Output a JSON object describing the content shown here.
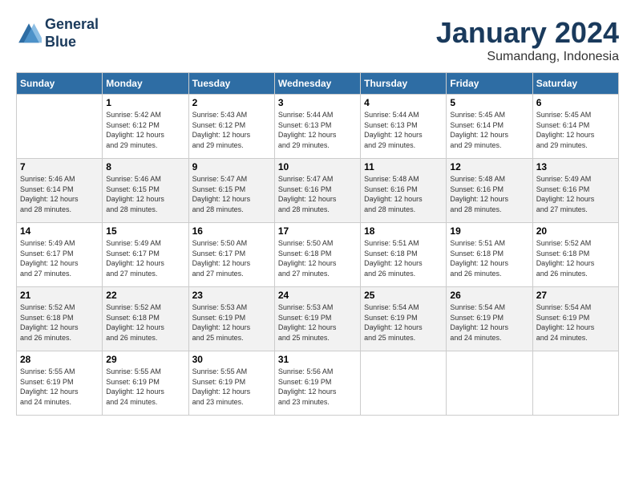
{
  "header": {
    "logo_line1": "General",
    "logo_line2": "Blue",
    "month": "January 2024",
    "location": "Sumandang, Indonesia"
  },
  "weekdays": [
    "Sunday",
    "Monday",
    "Tuesday",
    "Wednesday",
    "Thursday",
    "Friday",
    "Saturday"
  ],
  "weeks": [
    [
      {
        "num": "",
        "detail": ""
      },
      {
        "num": "1",
        "detail": "Sunrise: 5:42 AM\nSunset: 6:12 PM\nDaylight: 12 hours\nand 29 minutes."
      },
      {
        "num": "2",
        "detail": "Sunrise: 5:43 AM\nSunset: 6:12 PM\nDaylight: 12 hours\nand 29 minutes."
      },
      {
        "num": "3",
        "detail": "Sunrise: 5:44 AM\nSunset: 6:13 PM\nDaylight: 12 hours\nand 29 minutes."
      },
      {
        "num": "4",
        "detail": "Sunrise: 5:44 AM\nSunset: 6:13 PM\nDaylight: 12 hours\nand 29 minutes."
      },
      {
        "num": "5",
        "detail": "Sunrise: 5:45 AM\nSunset: 6:14 PM\nDaylight: 12 hours\nand 29 minutes."
      },
      {
        "num": "6",
        "detail": "Sunrise: 5:45 AM\nSunset: 6:14 PM\nDaylight: 12 hours\nand 29 minutes."
      }
    ],
    [
      {
        "num": "7",
        "detail": "Sunrise: 5:46 AM\nSunset: 6:14 PM\nDaylight: 12 hours\nand 28 minutes."
      },
      {
        "num": "8",
        "detail": "Sunrise: 5:46 AM\nSunset: 6:15 PM\nDaylight: 12 hours\nand 28 minutes."
      },
      {
        "num": "9",
        "detail": "Sunrise: 5:47 AM\nSunset: 6:15 PM\nDaylight: 12 hours\nand 28 minutes."
      },
      {
        "num": "10",
        "detail": "Sunrise: 5:47 AM\nSunset: 6:16 PM\nDaylight: 12 hours\nand 28 minutes."
      },
      {
        "num": "11",
        "detail": "Sunrise: 5:48 AM\nSunset: 6:16 PM\nDaylight: 12 hours\nand 28 minutes."
      },
      {
        "num": "12",
        "detail": "Sunrise: 5:48 AM\nSunset: 6:16 PM\nDaylight: 12 hours\nand 28 minutes."
      },
      {
        "num": "13",
        "detail": "Sunrise: 5:49 AM\nSunset: 6:16 PM\nDaylight: 12 hours\nand 27 minutes."
      }
    ],
    [
      {
        "num": "14",
        "detail": "Sunrise: 5:49 AM\nSunset: 6:17 PM\nDaylight: 12 hours\nand 27 minutes."
      },
      {
        "num": "15",
        "detail": "Sunrise: 5:49 AM\nSunset: 6:17 PM\nDaylight: 12 hours\nand 27 minutes."
      },
      {
        "num": "16",
        "detail": "Sunrise: 5:50 AM\nSunset: 6:17 PM\nDaylight: 12 hours\nand 27 minutes."
      },
      {
        "num": "17",
        "detail": "Sunrise: 5:50 AM\nSunset: 6:18 PM\nDaylight: 12 hours\nand 27 minutes."
      },
      {
        "num": "18",
        "detail": "Sunrise: 5:51 AM\nSunset: 6:18 PM\nDaylight: 12 hours\nand 26 minutes."
      },
      {
        "num": "19",
        "detail": "Sunrise: 5:51 AM\nSunset: 6:18 PM\nDaylight: 12 hours\nand 26 minutes."
      },
      {
        "num": "20",
        "detail": "Sunrise: 5:52 AM\nSunset: 6:18 PM\nDaylight: 12 hours\nand 26 minutes."
      }
    ],
    [
      {
        "num": "21",
        "detail": "Sunrise: 5:52 AM\nSunset: 6:18 PM\nDaylight: 12 hours\nand 26 minutes."
      },
      {
        "num": "22",
        "detail": "Sunrise: 5:52 AM\nSunset: 6:18 PM\nDaylight: 12 hours\nand 26 minutes."
      },
      {
        "num": "23",
        "detail": "Sunrise: 5:53 AM\nSunset: 6:19 PM\nDaylight: 12 hours\nand 25 minutes."
      },
      {
        "num": "24",
        "detail": "Sunrise: 5:53 AM\nSunset: 6:19 PM\nDaylight: 12 hours\nand 25 minutes."
      },
      {
        "num": "25",
        "detail": "Sunrise: 5:54 AM\nSunset: 6:19 PM\nDaylight: 12 hours\nand 25 minutes."
      },
      {
        "num": "26",
        "detail": "Sunrise: 5:54 AM\nSunset: 6:19 PM\nDaylight: 12 hours\nand 24 minutes."
      },
      {
        "num": "27",
        "detail": "Sunrise: 5:54 AM\nSunset: 6:19 PM\nDaylight: 12 hours\nand 24 minutes."
      }
    ],
    [
      {
        "num": "28",
        "detail": "Sunrise: 5:55 AM\nSunset: 6:19 PM\nDaylight: 12 hours\nand 24 minutes."
      },
      {
        "num": "29",
        "detail": "Sunrise: 5:55 AM\nSunset: 6:19 PM\nDaylight: 12 hours\nand 24 minutes."
      },
      {
        "num": "30",
        "detail": "Sunrise: 5:55 AM\nSunset: 6:19 PM\nDaylight: 12 hours\nand 23 minutes."
      },
      {
        "num": "31",
        "detail": "Sunrise: 5:56 AM\nSunset: 6:19 PM\nDaylight: 12 hours\nand 23 minutes."
      },
      {
        "num": "",
        "detail": ""
      },
      {
        "num": "",
        "detail": ""
      },
      {
        "num": "",
        "detail": ""
      }
    ]
  ]
}
